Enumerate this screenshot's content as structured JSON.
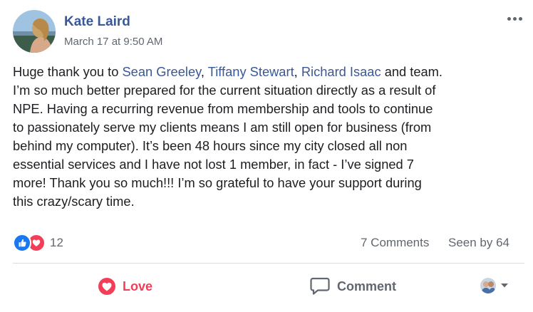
{
  "post": {
    "author": "Kate Laird",
    "timestamp": "March 17 at 9:50 AM",
    "more_icon": "ellipsis-icon",
    "text_lines": [
      [
        "Huge thank you to ",
        "@Sean Greeley",
        ", ",
        "@Tiffany Stewart",
        ", ",
        "@Richard Isaac",
        " and team."
      ],
      [
        "I’m so much better prepared for the current situation directly as a result of"
      ],
      [
        "NPE. Having a recurring revenue from membership and tools to continue"
      ],
      [
        "to passionately serve my clients means I am still open for business (from"
      ],
      [
        "behind my computer). It’s been 48 hours since my city closed all non"
      ],
      [
        "essential services and I have not lost 1 member, in fact - I’ve signed 7"
      ],
      [
        "more! Thank you so much!!! I’m so grateful to have your support during"
      ],
      [
        "this crazy/scary time."
      ]
    ]
  },
  "reactions": {
    "count": "12",
    "icons": [
      "like-reaction-icon",
      "love-reaction-icon"
    ]
  },
  "stats": {
    "comments": "7 Comments",
    "seen": "Seen by 64"
  },
  "actions": {
    "love_label": "Love",
    "comment_label": "Comment"
  },
  "colors": {
    "link": "#385898",
    "love": "#f33e58",
    "like": "#1877f2",
    "muted": "#606770"
  }
}
